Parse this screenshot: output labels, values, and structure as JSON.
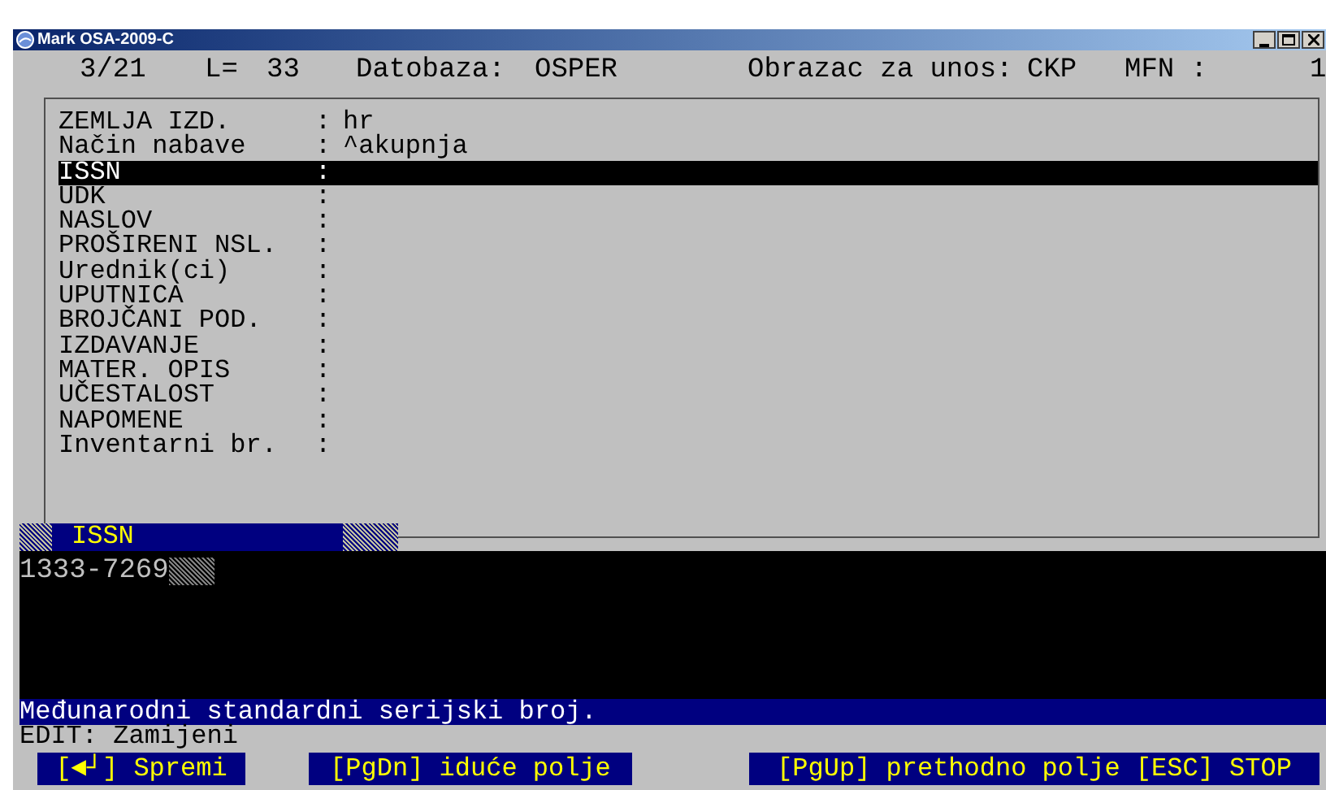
{
  "window": {
    "title": "Mark OSA-2009-C"
  },
  "header": [
    "3/21",
    "L=",
    "33",
    "Datobaza:",
    "OSPER",
    "Obrazac za unos:",
    "CKP",
    "MFN :",
    "1"
  ],
  "fields": [
    {
      "label": "ZEMLJA IZD.",
      "separator": ":",
      "value": "hr",
      "selected": false
    },
    {
      "label": "Način nabave",
      "separator": ":",
      "value": "^akupnja",
      "selected": false
    },
    {
      "label": "ISSN",
      "separator": ":",
      "selected": true
    },
    {
      "label": "UDK",
      "separator": ":",
      "selected": false
    },
    {
      "label": "NASLOV",
      "separator": ":",
      "selected": false
    },
    {
      "label": "PROŠIRENI NSL.",
      "separator": ":",
      "selected": false
    },
    {
      "label": "Urednik(ci)",
      "separator": ":",
      "selected": false
    },
    {
      "label": "UPUTNICA",
      "separator": ":",
      "selected": false
    },
    {
      "label": "BROJČANI POD.",
      "separator": ":",
      "selected": false
    },
    {
      "label": "IZDAVANJE",
      "separator": ":",
      "selected": false
    },
    {
      "label": "MATER. OPIS",
      "separator": ":",
      "selected": false
    },
    {
      "label": "UČESTALOST",
      "separator": ":",
      "selected": false
    },
    {
      "label": "NAPOMENE",
      "separator": ":",
      "selected": false
    },
    {
      "label": "Inventarni br.",
      "separator": ":",
      "selected": false
    }
  ],
  "edit_field": {
    "label": "ISSN",
    "value": "1333-7269"
  },
  "help": "Međunarodni standardni serijski broj.",
  "mode": "EDIT: Zamijeni",
  "keys": [
    {
      "label": "[◄┘] Spremi"
    },
    {
      "label": "[PgDn] iduće polje"
    },
    {
      "label": "[PgUp] prethodno polje [ESC] STOP"
    }
  ]
}
